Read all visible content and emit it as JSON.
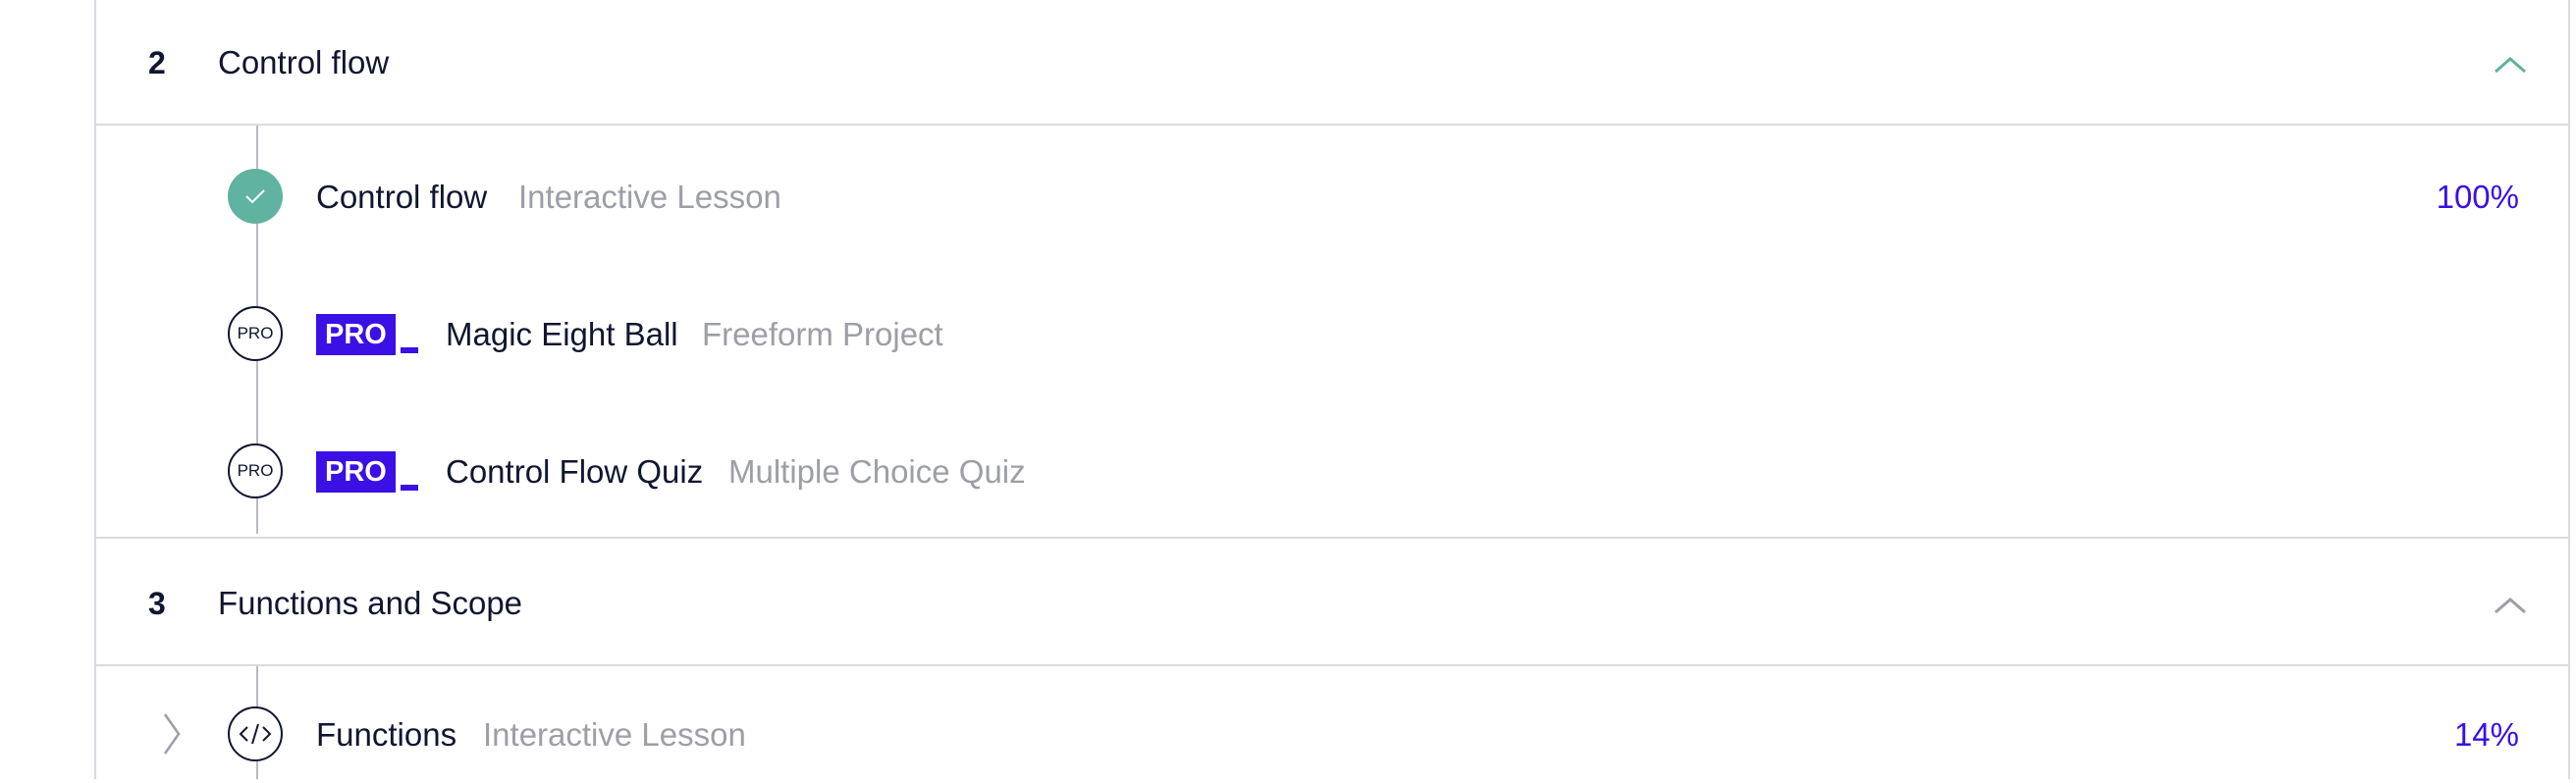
{
  "modules": [
    {
      "number": "2",
      "title": "Control flow",
      "chevron_color": "#5fb3a0",
      "items": [
        {
          "status": "complete",
          "node_icon": "check-icon",
          "pro": false,
          "title": "Control flow",
          "type": "Interactive Lesson",
          "progress": "100%"
        },
        {
          "status": "locked-pro",
          "node_icon": "pro-icon",
          "node_label": "PRO",
          "pro": true,
          "pro_label": "PRO",
          "title": "Magic Eight Ball",
          "type": "Freeform Project"
        },
        {
          "status": "locked-pro",
          "node_icon": "pro-icon",
          "node_label": "PRO",
          "pro": true,
          "pro_label": "PRO",
          "title": "Control Flow Quiz",
          "type": "Multiple Choice Quiz"
        }
      ]
    },
    {
      "number": "3",
      "title": "Functions and Scope",
      "chevron_color": "#9c9ea8",
      "items": [
        {
          "status": "in-progress",
          "node_icon": "code-icon",
          "expand_icon": "chevron-right-icon",
          "pro": false,
          "title": "Functions",
          "type": "Interactive Lesson",
          "progress": "14%"
        }
      ]
    }
  ],
  "colors": {
    "accent": "#3a10e5",
    "complete": "#5fb3a0",
    "text": "#10162f",
    "muted": "#9c9ea8",
    "border": "#d9dbe0"
  }
}
